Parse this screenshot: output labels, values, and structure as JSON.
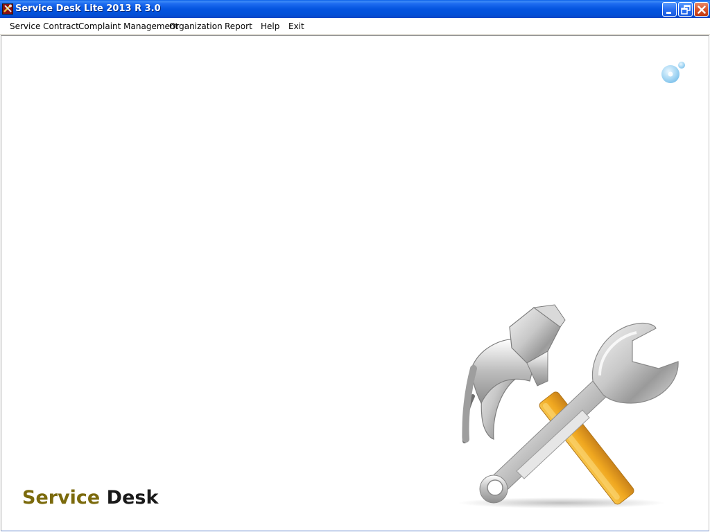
{
  "window": {
    "title": "Service Desk Lite 2013 R 3.0",
    "icon": "app-tools-icon",
    "controls": [
      "minimize-icon",
      "restore-icon",
      "close-icon"
    ]
  },
  "menu": {
    "items": [
      {
        "label": "Service Contract"
      },
      {
        "label": "Complaint Management"
      },
      {
        "label": "Organization"
      },
      {
        "label": "Report"
      },
      {
        "label": "Help"
      },
      {
        "label": "Exit"
      }
    ]
  },
  "branding": {
    "word1": "Service",
    "word2": "Desk",
    "word1_color": "#7b6a0c",
    "word2_color": "#1a1a1a",
    "illustration": "hammer-and-wrench-icon",
    "corner_logo": "bubbles-logo-icon"
  },
  "colors": {
    "titlebar": "#0454e0",
    "close_button": "#d9542a",
    "background": "#ffffff"
  }
}
